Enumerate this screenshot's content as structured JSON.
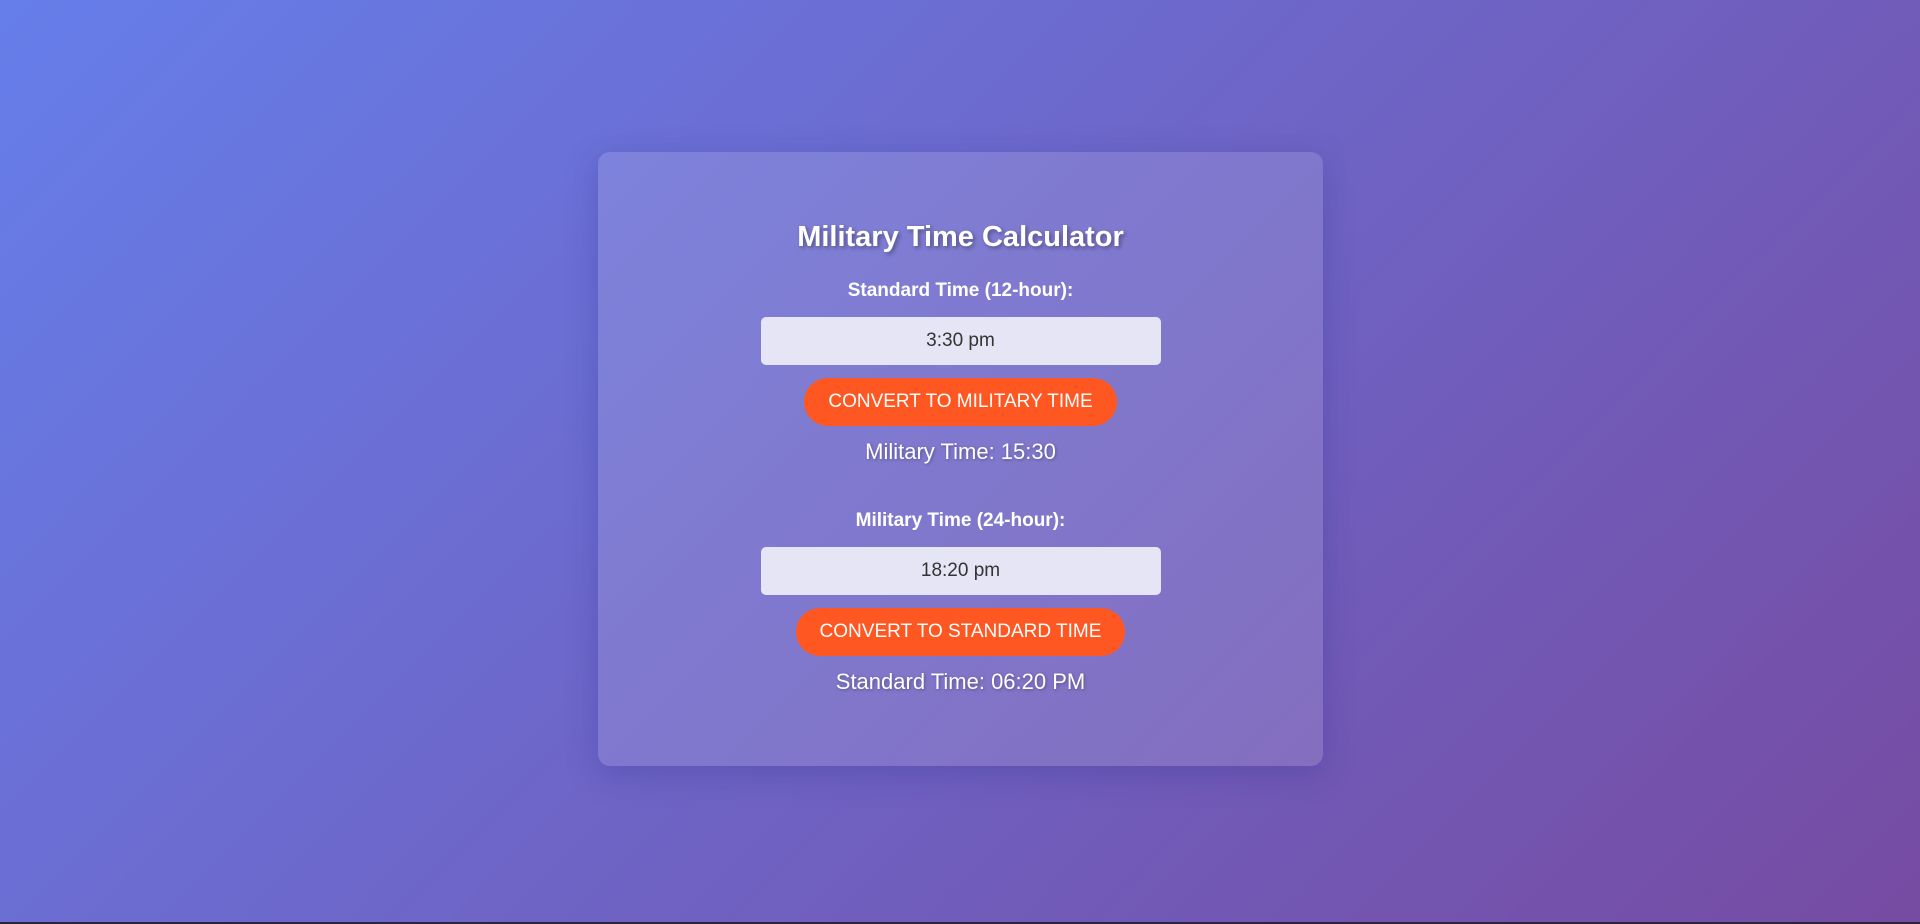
{
  "page": {
    "background_start": "#667eea",
    "background_end": "#764ba2"
  },
  "calculator": {
    "title": "Military Time Calculator",
    "standard_section": {
      "label": "Standard Time (12-hour):",
      "input_value": "3:30 pm",
      "button_label": "Convert to Military Time",
      "result_prefix": "Military Time:",
      "result_value": "15:30",
      "result_text": "Military Time: 15:30"
    },
    "military_section": {
      "label": "Military Time (24-hour):",
      "input_value": "18:20 pm",
      "button_label": "Convert to Standard Time",
      "result_prefix": "Standard Time:",
      "result_value": "06:20 PM",
      "result_text": "Standard Time: 06:20 PM"
    },
    "accent_color": "#ff5722"
  }
}
